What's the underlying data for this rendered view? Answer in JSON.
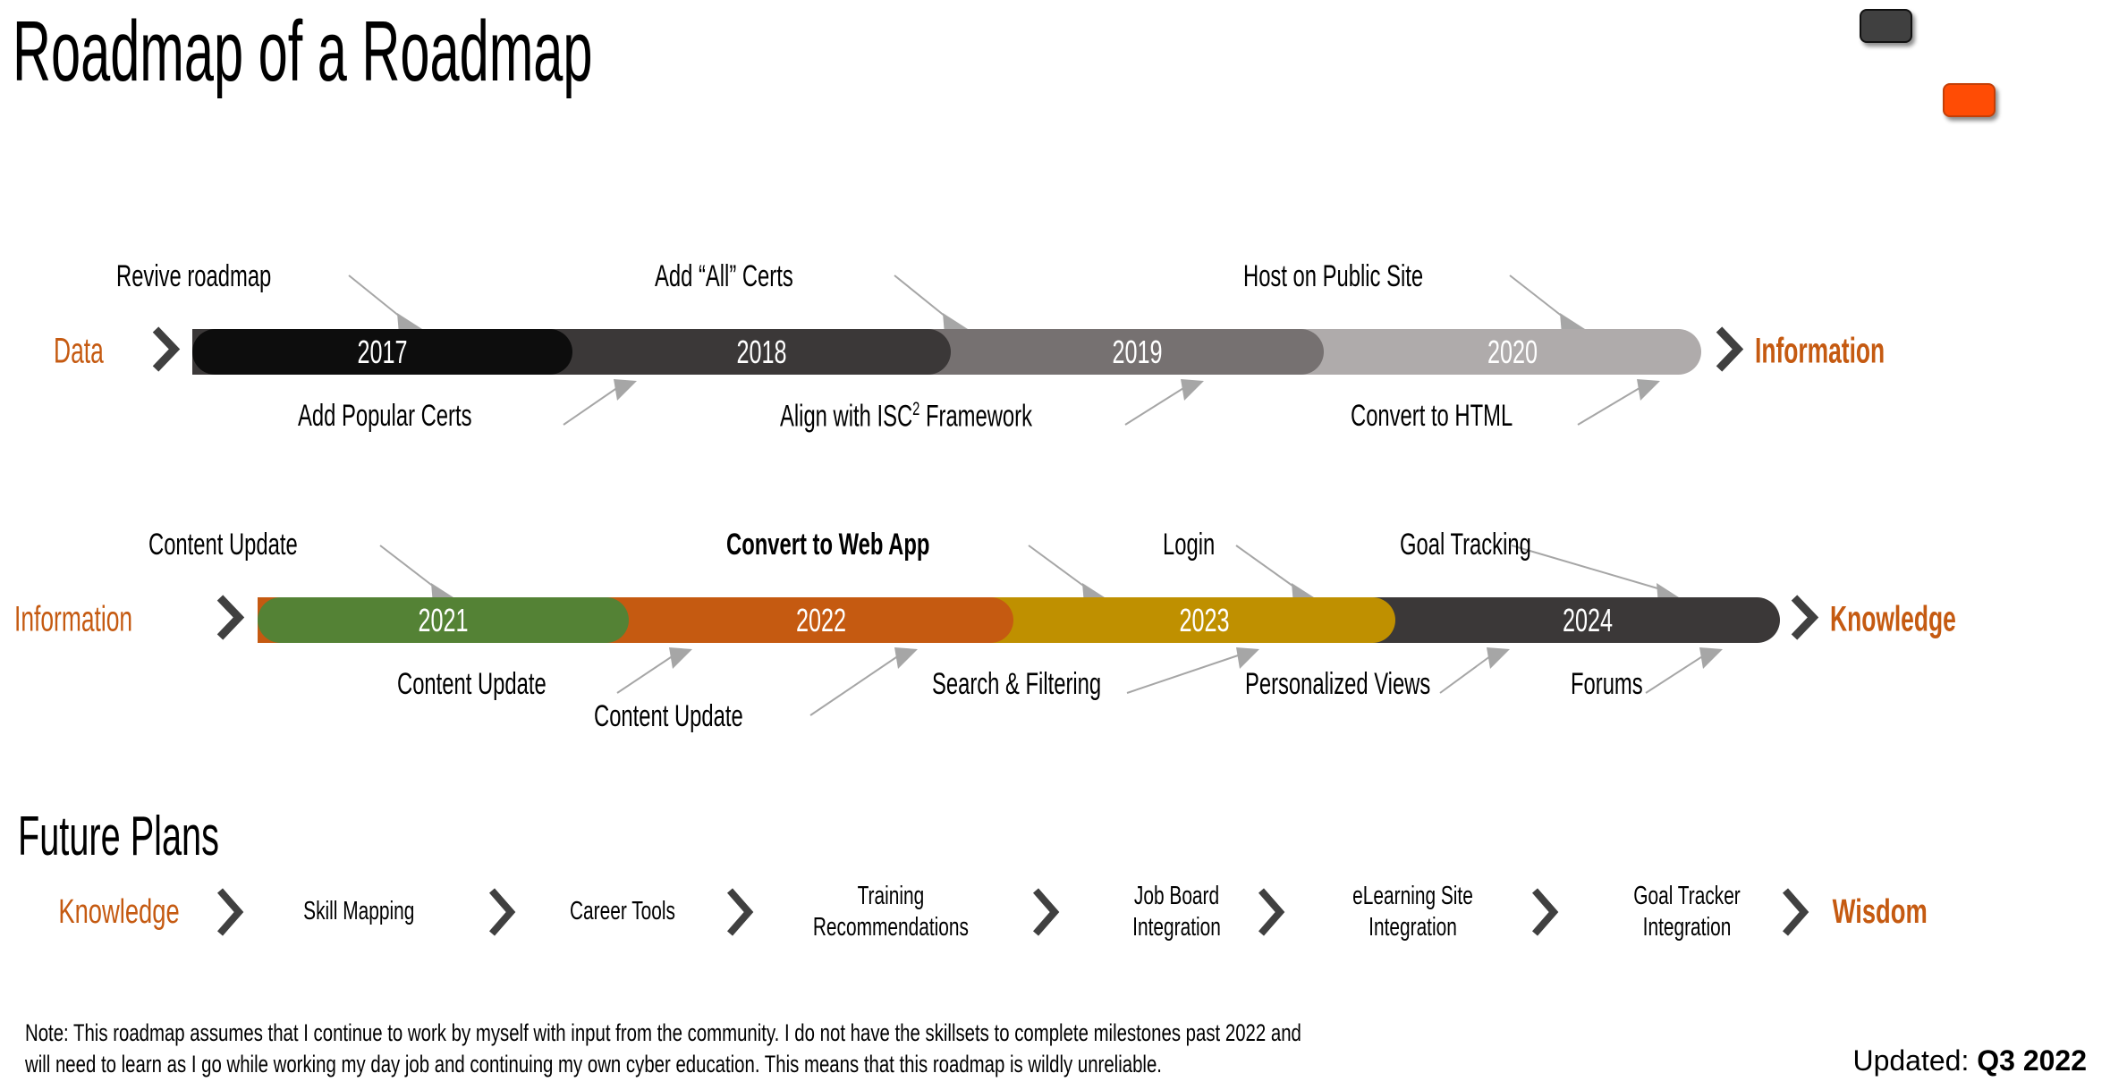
{
  "title": "Roadmap of a Roadmap",
  "colors": {
    "accent_orange": "#C55A11",
    "chevron_gray": "#404040",
    "leader_gray": "#A6A6A6",
    "shape_dark": "#404040",
    "shape_orange": "#FF4C05",
    "bar_2017": "#0D0D0D",
    "bar_2018": "#3B3838",
    "bar_2019": "#767171",
    "bar_2020": "#AFABAB",
    "bar_2021": "#548235",
    "bar_2022": "#C55A11",
    "bar_2023": "#BF9000",
    "bar_2024": "#3B3838"
  },
  "shapes": [
    {
      "name": "dark-rounded-rect",
      "color": "#404040"
    },
    {
      "name": "orange-rounded-rect",
      "color": "#FF4C05"
    }
  ],
  "timeline_data": {
    "type": "table",
    "rows": [
      {
        "start_label": "Data",
        "end_label": "Information",
        "segments": [
          {
            "year": "2017",
            "color": "#0D0D0D",
            "above": [
              "Revive roadmap"
            ],
            "below": [
              "Add Popular Certs"
            ]
          },
          {
            "year": "2018",
            "color": "#3B3838",
            "above": [
              "Add “All” Certs"
            ],
            "below": [
              "Align with ISC² Framework"
            ]
          },
          {
            "year": "2019",
            "color": "#767171",
            "above": [],
            "below": []
          },
          {
            "year": "2020",
            "color": "#AFABAB",
            "above": [
              "Host on Public Site"
            ],
            "below": [
              "Convert to HTML"
            ]
          }
        ]
      },
      {
        "start_label": "Information",
        "end_label": "Knowledge",
        "segments": [
          {
            "year": "2021",
            "color": "#548235",
            "above": [
              "Content Update"
            ],
            "below": [
              "Content Update"
            ]
          },
          {
            "year": "2022",
            "color": "#C55A11",
            "above": [
              "Convert to Web App"
            ],
            "below": [
              "Content Update"
            ]
          },
          {
            "year": "2023",
            "color": "#BF9000",
            "above": [
              "Login"
            ],
            "below": [
              "Search & Filtering",
              "Personalized Views"
            ]
          },
          {
            "year": "2024",
            "color": "#3B3838",
            "above": [
              "Goal Tracking"
            ],
            "below": [
              "Forums"
            ]
          }
        ]
      }
    ]
  },
  "row1": {
    "start_label": "Data",
    "end_label": "Information",
    "segments": [
      {
        "year": "2017",
        "color": "#0D0D0D"
      },
      {
        "year": "2018",
        "color": "#3B3838"
      },
      {
        "year": "2019",
        "color": "#767171"
      },
      {
        "year": "2020",
        "color": "#AFABAB"
      }
    ],
    "milestones_above": [
      {
        "text": "Revive roadmap"
      },
      {
        "text": "Add “All” Certs"
      },
      {
        "text": "Host on Public Site"
      }
    ],
    "milestones_below": [
      {
        "text": "Add Popular Certs"
      },
      {
        "text_pre": "Align with ISC",
        "text_sup": "2",
        "text_post": " Framework"
      },
      {
        "text": "Convert to HTML"
      }
    ]
  },
  "row2": {
    "start_label": "Information",
    "end_label": "Knowledge",
    "segments": [
      {
        "year": "2021",
        "color": "#548235"
      },
      {
        "year": "2022",
        "color": "#C55A11"
      },
      {
        "year": "2023",
        "color": "#BF9000"
      },
      {
        "year": "2024",
        "color": "#3B3838"
      }
    ],
    "milestones_above": [
      {
        "text": "Content Update"
      },
      {
        "text": "Convert to Web App",
        "bold": true
      },
      {
        "text": "Login"
      },
      {
        "text": "Goal Tracking"
      }
    ],
    "milestones_below": [
      {
        "text": "Content Update"
      },
      {
        "text": "Content Update"
      },
      {
        "text": "Search & Filtering"
      },
      {
        "text": "Personalized Views"
      },
      {
        "text": "Forums"
      }
    ]
  },
  "future": {
    "heading": "Future Plans",
    "start_label": "Knowledge",
    "end_label": "Wisdom",
    "items": [
      {
        "line1": "Skill Mapping",
        "line2": ""
      },
      {
        "line1": "Career Tools",
        "line2": ""
      },
      {
        "line1": "Training",
        "line2": "Recommendations"
      },
      {
        "line1": "Job Board",
        "line2": "Integration"
      },
      {
        "line1": "eLearning Site",
        "line2": "Integration"
      },
      {
        "line1": "Goal Tracker",
        "line2": "Integration"
      }
    ]
  },
  "footer": {
    "note": "Note: This roadmap assumes that I continue to work by myself with input from the community. I do not have the skillsets to complete milestones past 2022 and will need to learn as I go while working my day job and continuing my own cyber education. This means that this roadmap is wildly unreliable.",
    "updated_prefix": "Updated: ",
    "updated_value": "Q3 2022"
  }
}
